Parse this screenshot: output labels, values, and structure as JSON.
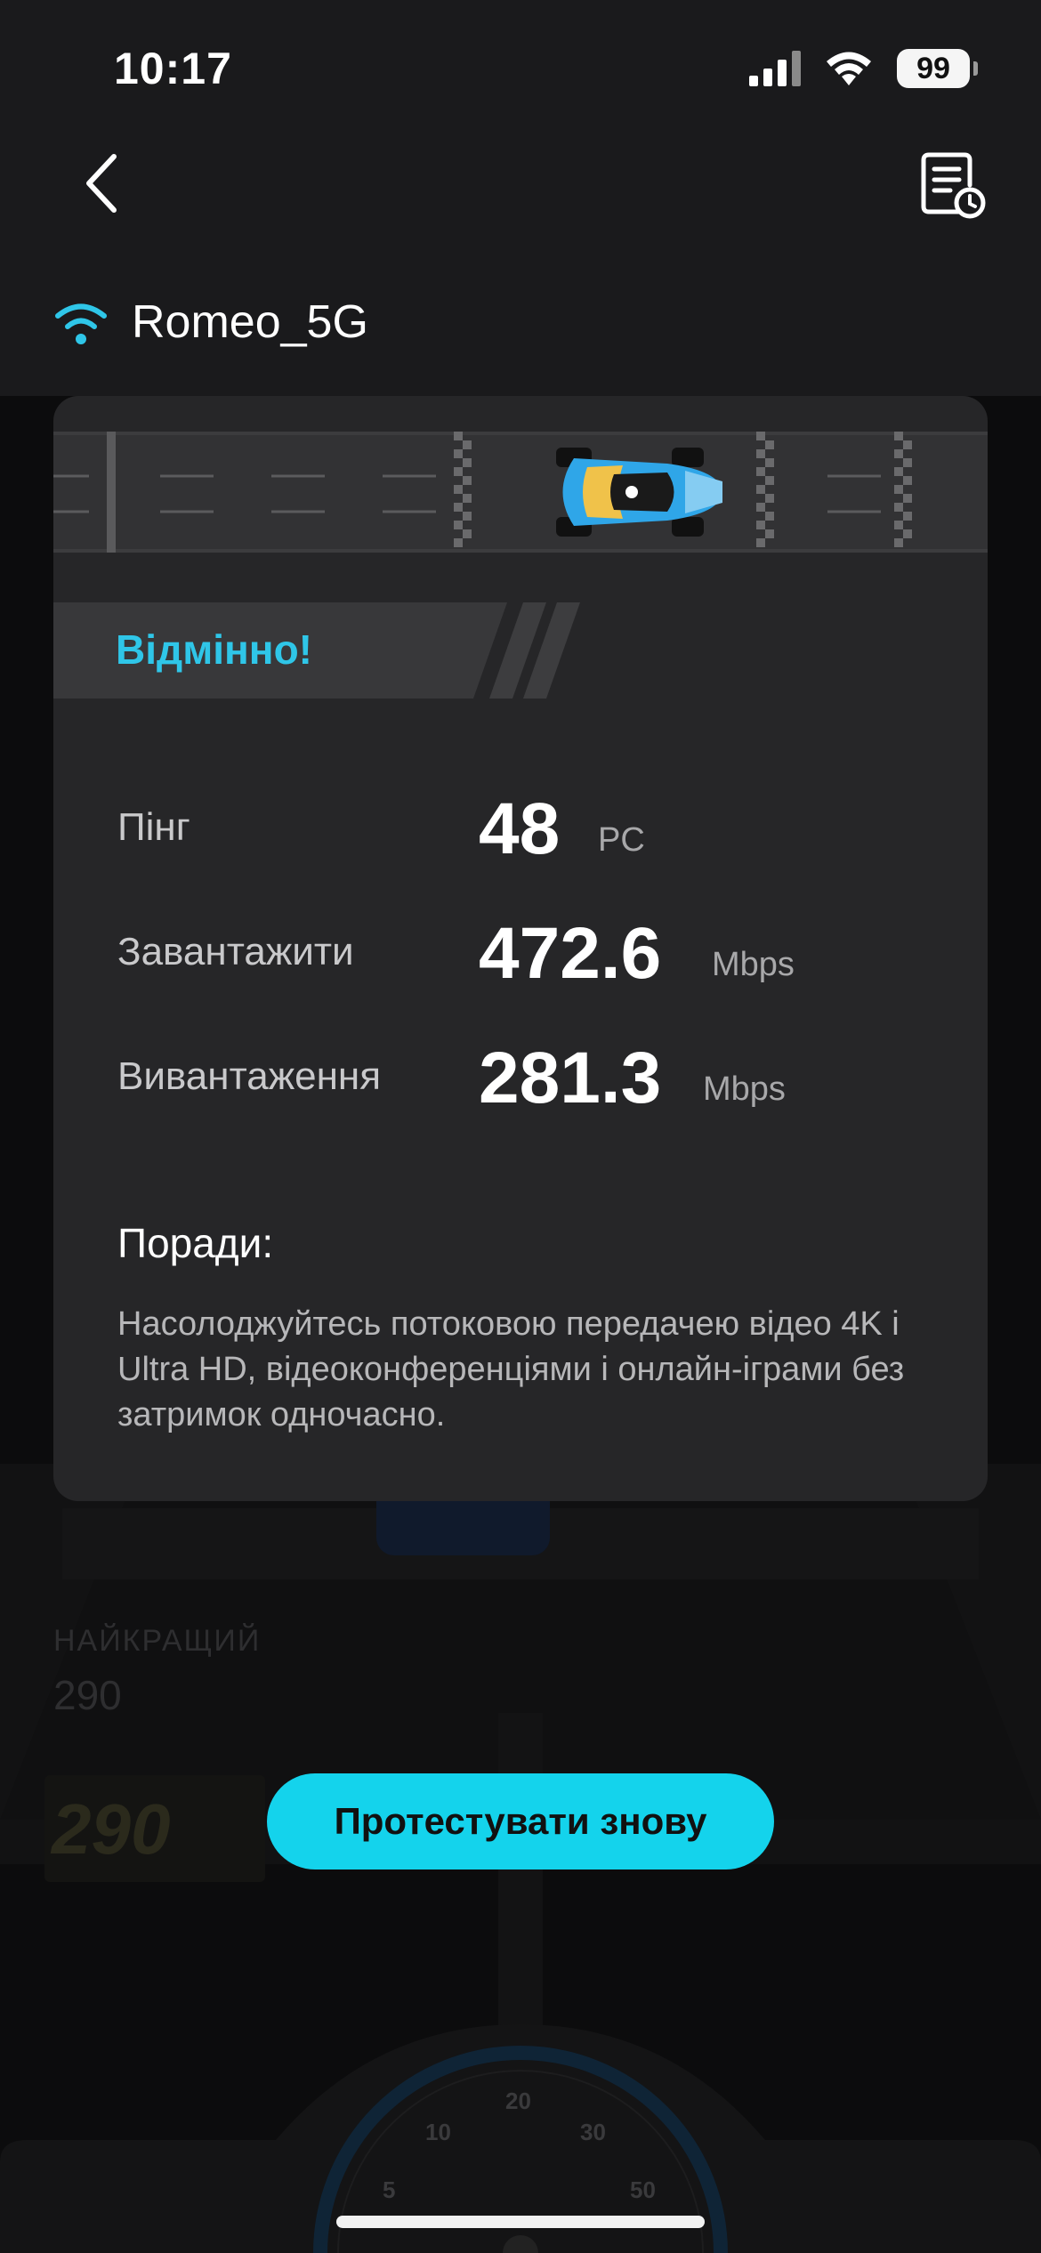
{
  "status_bar": {
    "time": "10:17",
    "battery": "99"
  },
  "network": {
    "ssid": "Romeo_5G"
  },
  "result": {
    "rating": "Відмінно!",
    "metrics": [
      {
        "label": "Пінг",
        "value": "48",
        "unit": "PC"
      },
      {
        "label": "Завантажити",
        "value": "472.6",
        "unit": "Mbps"
      },
      {
        "label": "Вивантаження",
        "value": "281.3",
        "unit": "Mbps"
      }
    ],
    "tips_title": "Поради:",
    "tips_text": "Насолоджуйтесь потоковою передачею відео 4K і Ultra HD, відеоконференціями і онлайн-іграми без затримок одночасно."
  },
  "background": {
    "best_label": "НАЙКРАЩИЙ",
    "best_value": "290",
    "speed_value": "290",
    "gauge_ticks": [
      "5",
      "10",
      "20",
      "30",
      "50"
    ]
  },
  "actions": {
    "retest_label": "Протестувати знову"
  },
  "colors": {
    "accent": "#14d3ec",
    "rating": "#2fc6e8",
    "card": "#262628"
  }
}
